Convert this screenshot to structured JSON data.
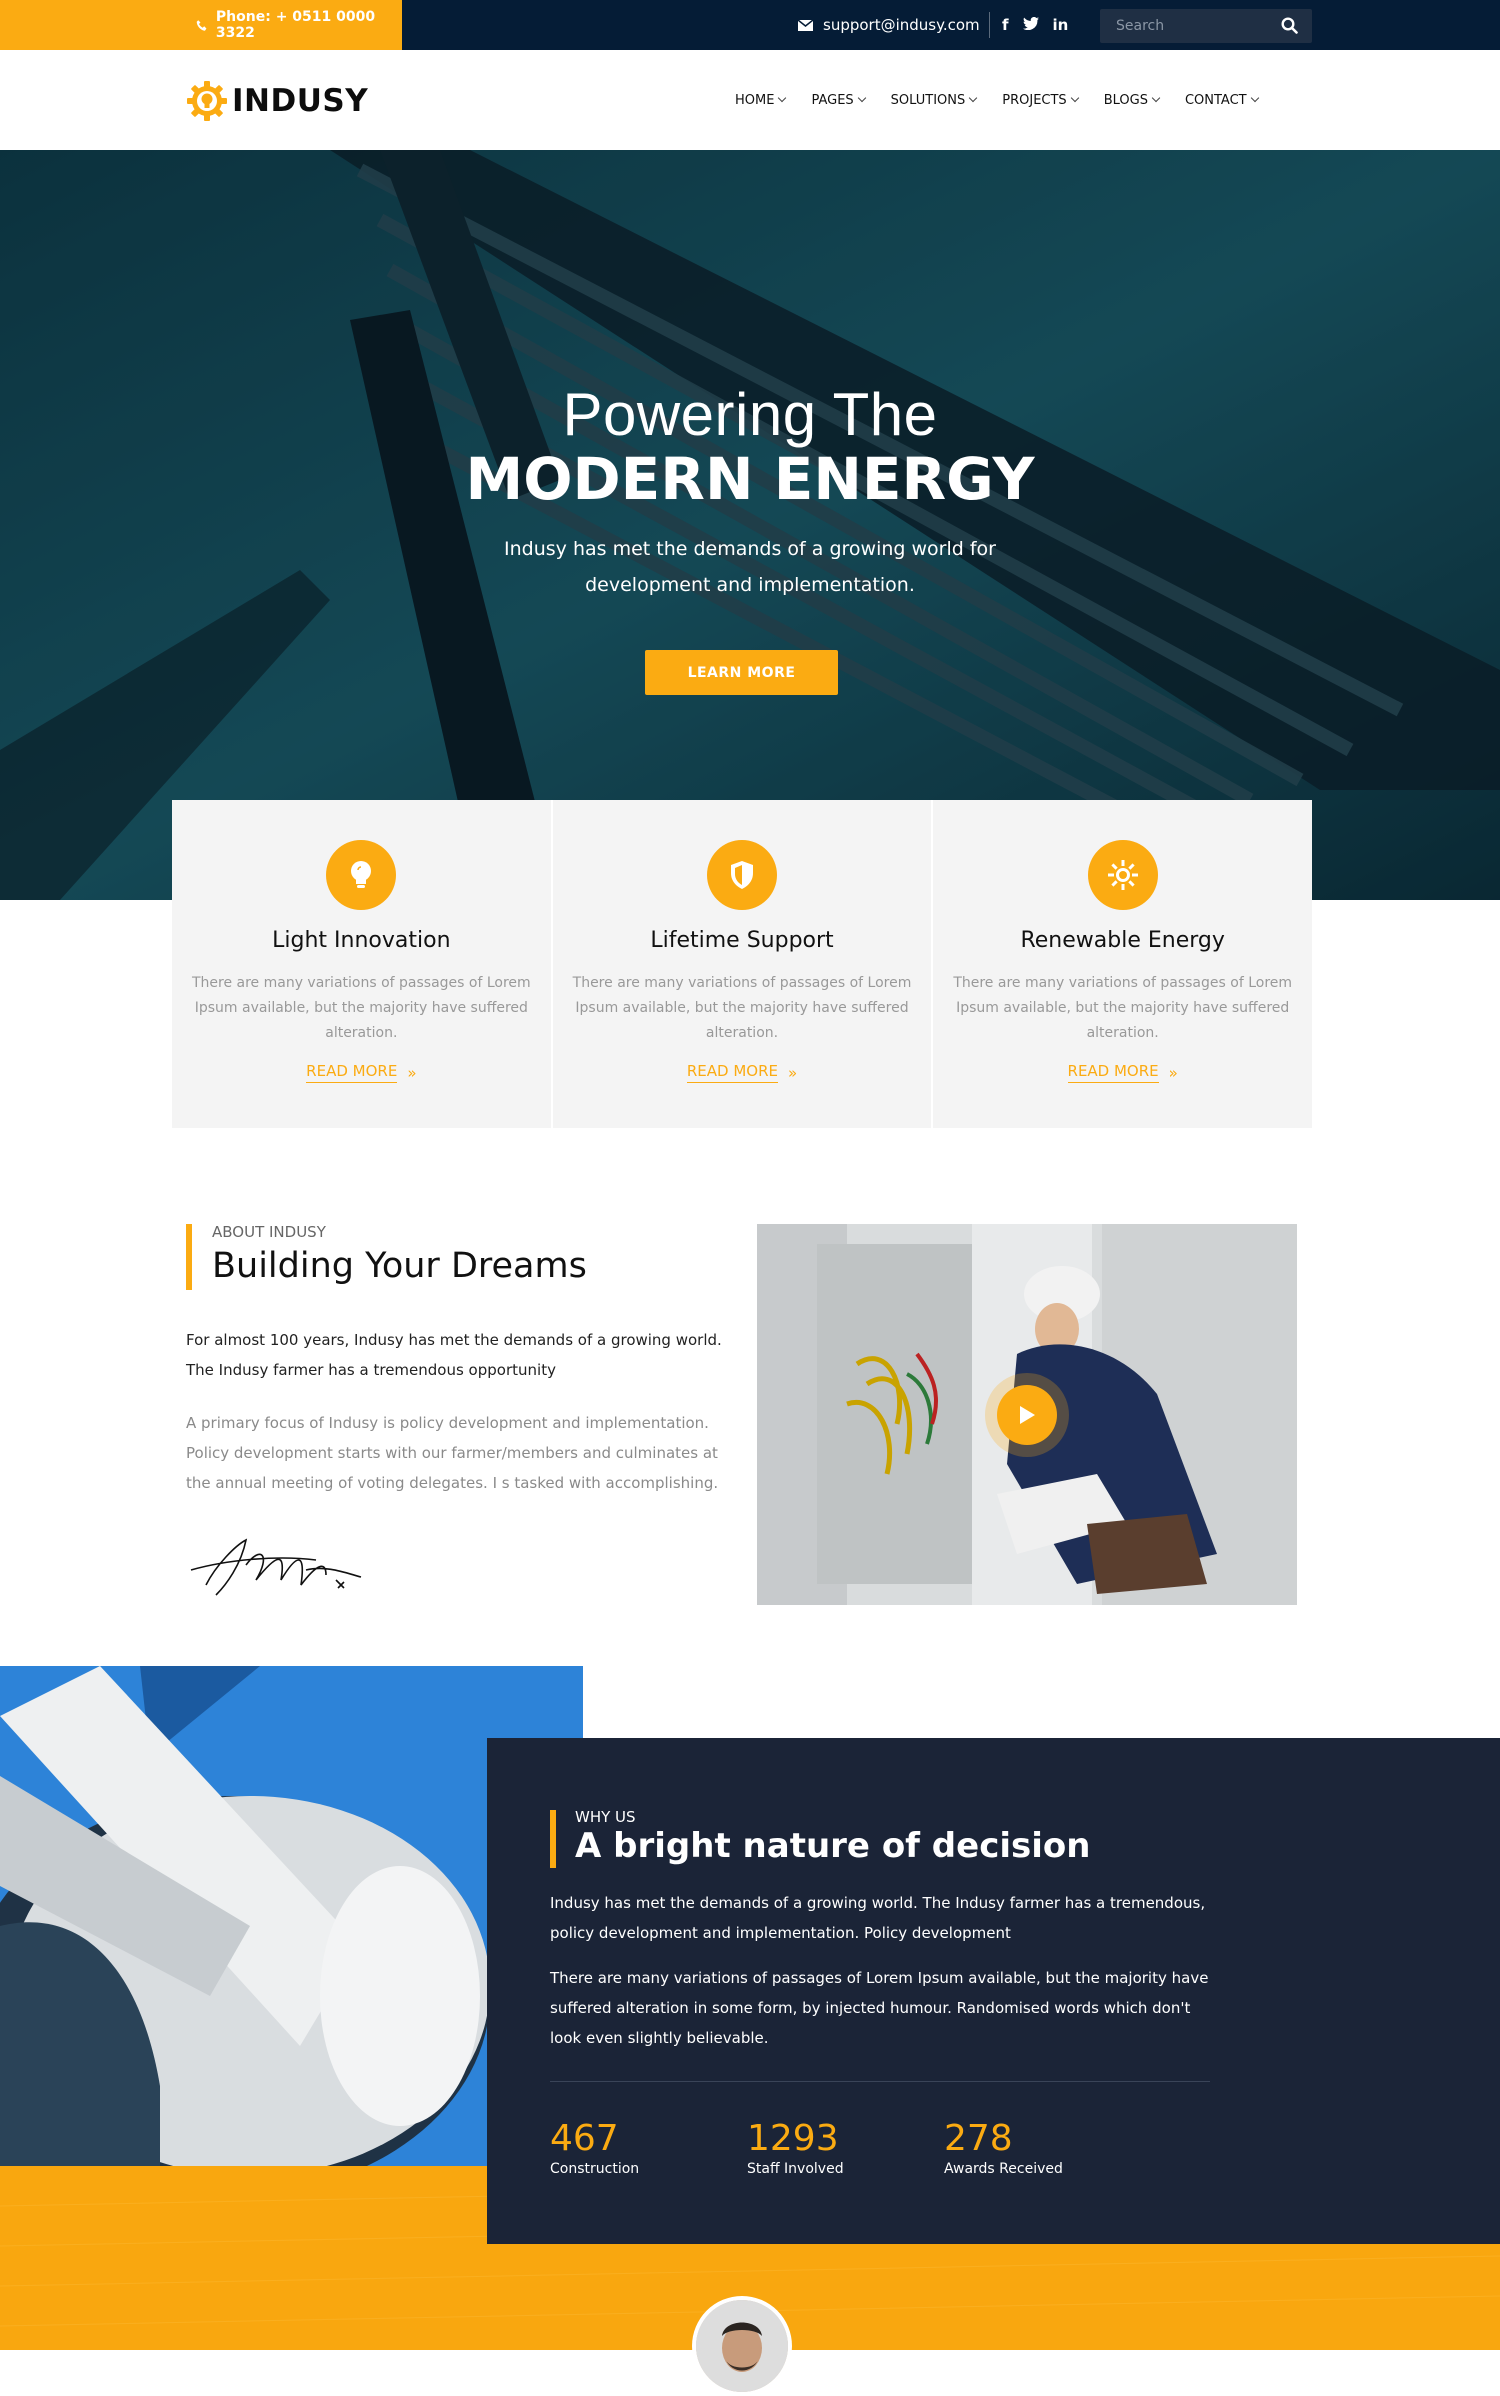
{
  "topbar": {
    "phone": "Phone: + 0511 0000 3322",
    "email": "support@indusy.com",
    "social": [
      "facebook-icon",
      "twitter-icon",
      "linkedin-icon"
    ],
    "search_placeholder": "Search"
  },
  "header": {
    "logo_text": "INDUSY",
    "nav": [
      {
        "label": "HOME"
      },
      {
        "label": "PAGES"
      },
      {
        "label": "SOLUTIONS"
      },
      {
        "label": "PROJECTS"
      },
      {
        "label": "BLOGS"
      },
      {
        "label": "CONTACT"
      }
    ]
  },
  "hero": {
    "title_line1": "Powering The",
    "title_line2": "MODERN ENERGY",
    "subtitle": "Indusy has met the demands of a growing world for development and implementation.",
    "button": "LEARN MORE"
  },
  "features": [
    {
      "icon": "lightbulb-icon",
      "title": "Light Innovation",
      "text": "There are many variations of passages of Lorem Ipsum available, but the majority have suffered alteration.",
      "link": "READ MORE"
    },
    {
      "icon": "shield-icon",
      "title": "Lifetime Support",
      "text": "There are many variations of passages of Lorem Ipsum available, but the majority have suffered alteration.",
      "link": "READ MORE"
    },
    {
      "icon": "sun-icon",
      "title": "Renewable Energy",
      "text": "There are many variations of passages of Lorem Ipsum available, but the majority have suffered alteration.",
      "link": "READ MORE"
    }
  ],
  "about": {
    "kicker": "ABOUT INDUSY",
    "title": "Building Your Dreams",
    "p1": "For almost 100 years, Indusy has met the demands of a growing world. The Indusy farmer has a tremendous opportunity",
    "p2": "A primary focus of Indusy is policy development and implementation. Policy development starts with our farmer/members and culminates at the annual meeting of voting delegates. I s tasked with accomplishing."
  },
  "why": {
    "kicker": "WHY US",
    "title": "A bright nature of decision",
    "p1": "Indusy has met the demands of a growing world. The Indusy farmer has a tremendous, policy development and implementation. Policy development",
    "p2": "There are many variations of passages of Lorem Ipsum available, but the majority have suffered alteration in some form, by injected humour. Randomised words which don't look even slightly believable.",
    "stats": [
      {
        "num": "467",
        "label": "Construction"
      },
      {
        "num": "1293",
        "label": "Staff Involved"
      },
      {
        "num": "278",
        "label": "Awards Received"
      }
    ]
  },
  "colors": {
    "accent": "#fbab12",
    "topbar": "#051c36",
    "dark_panel": "#1b2437"
  }
}
